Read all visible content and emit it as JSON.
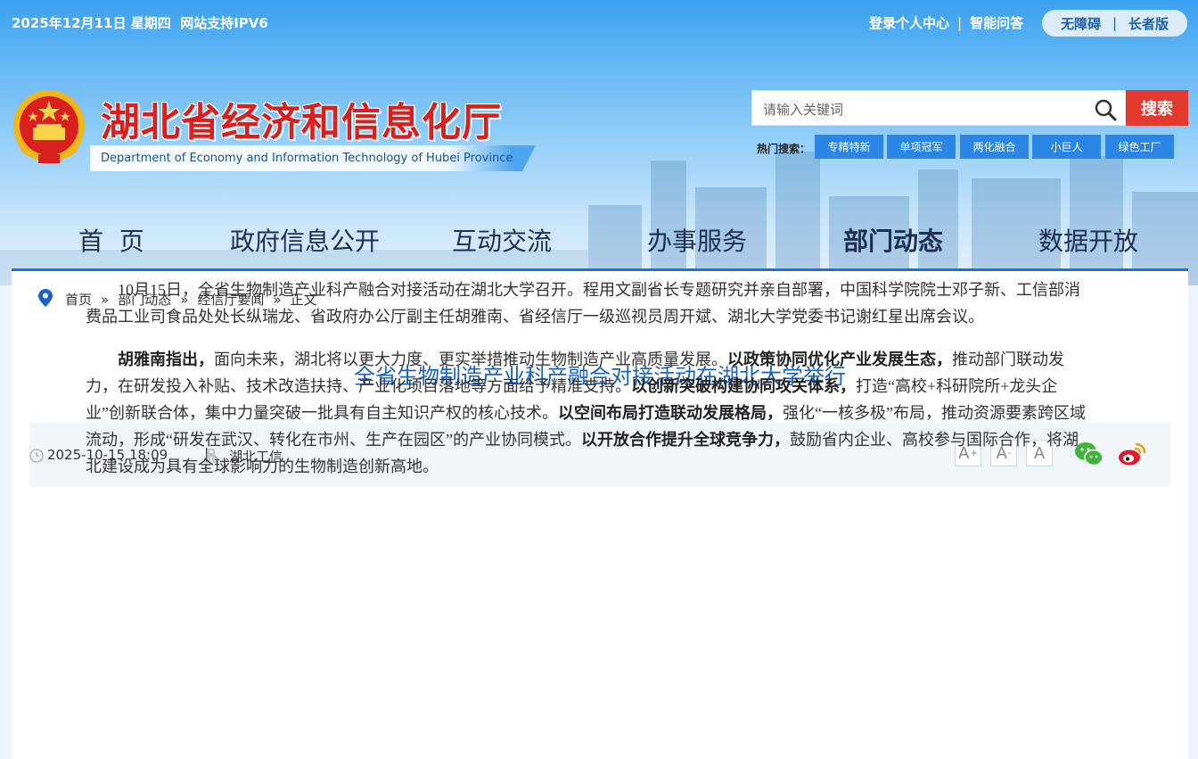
{
  "topbar": {
    "date": "2025年12月11日 星期四",
    "ipv6": "网站支持IPV6",
    "login": "登录个人中心",
    "qa": "智能问答",
    "accessibility": "无障碍",
    "elderly": "长者版"
  },
  "brand": {
    "title_cn": "湖北省经济和信息化厅",
    "title_en": "Department of Economy and Information Technology of Hubei Province"
  },
  "search": {
    "placeholder": "请输入关键词",
    "button": "搜索",
    "hot_label": "热门搜索：",
    "hot_tags": [
      "专精特新",
      "单项冠军",
      "两化融合",
      "小巨人",
      "绿色工厂"
    ]
  },
  "nav": {
    "items": [
      "首  页",
      "政府信息公开",
      "互动交流",
      "办事服务",
      "部门动态",
      "数据开放"
    ],
    "active": "部门动态"
  },
  "breadcrumb": [
    "首页",
    "部门动态",
    "经信厅要闻",
    "正文"
  ],
  "breadcrumb_sep": "»",
  "article": {
    "title": "全省生物制造产业科产融合对接活动在湖北大学举行",
    "date": "2025-10-15 18:09",
    "meta_sep": "|",
    "source": "湖北工信",
    "font_buttons": [
      "A",
      "A",
      "A"
    ],
    "font_marks": [
      "+",
      "-"
    ],
    "p1": "10月15日，全省生物制造产业科产融合对接活动在湖北大学召开。程用文副省长专题研究并亲自部署，中国科学院院士邓子新、工信部消费品工业司食品处处长纵瑞龙、省政府办公厅副主任胡雅南、省经信厅一级巡视员周开斌、湖北大学党委书记谢红星出席会议。",
    "p2_parts": [
      {
        "bold": true,
        "text": "胡雅南指出，"
      },
      {
        "bold": false,
        "text": "面向未来，湖北将以更大力度、更实举措推动生物制造产业高质量发展。"
      },
      {
        "bold": true,
        "text": "以政策协同优化产业发展生态，"
      },
      {
        "bold": false,
        "text": "推动部门联动发力，在研发投入补贴、技术改造扶持、产业化项目落地等方面给予精准支持。"
      },
      {
        "bold": true,
        "text": "以创新突破构建协同攻关体系，"
      },
      {
        "bold": false,
        "text": "打造“高校+科研院所+龙头企业”创新联合体，集中力量突破一批具有自主知识产权的核心技术。"
      },
      {
        "bold": true,
        "text": "以空间布局打造联动发展格局，"
      },
      {
        "bold": false,
        "text": "强化“一核多极”布局，推动资源要素跨区域流动，形成“研发在武汉、转化在市州、生产在园区”的产业协同模式。"
      },
      {
        "bold": true,
        "text": "以开放合作提升全球竞争力，"
      },
      {
        "bold": false,
        "text": "鼓励省内企业、高校参与国际合作，将湖北建设成为具有全球影响力的生物制造创新高地。"
      }
    ]
  },
  "colors": {
    "brand_red": "#d9201e",
    "nav_blue": "#1f71d6",
    "title_blue": "#1a63c4",
    "search_red": "#e33a2f",
    "tag_blue": "#2b86e6"
  },
  "icons": [
    "national-emblem-icon",
    "search-icon",
    "location-pin-icon",
    "clock-icon",
    "source-icon",
    "wechat-icon",
    "weibo-icon"
  ]
}
